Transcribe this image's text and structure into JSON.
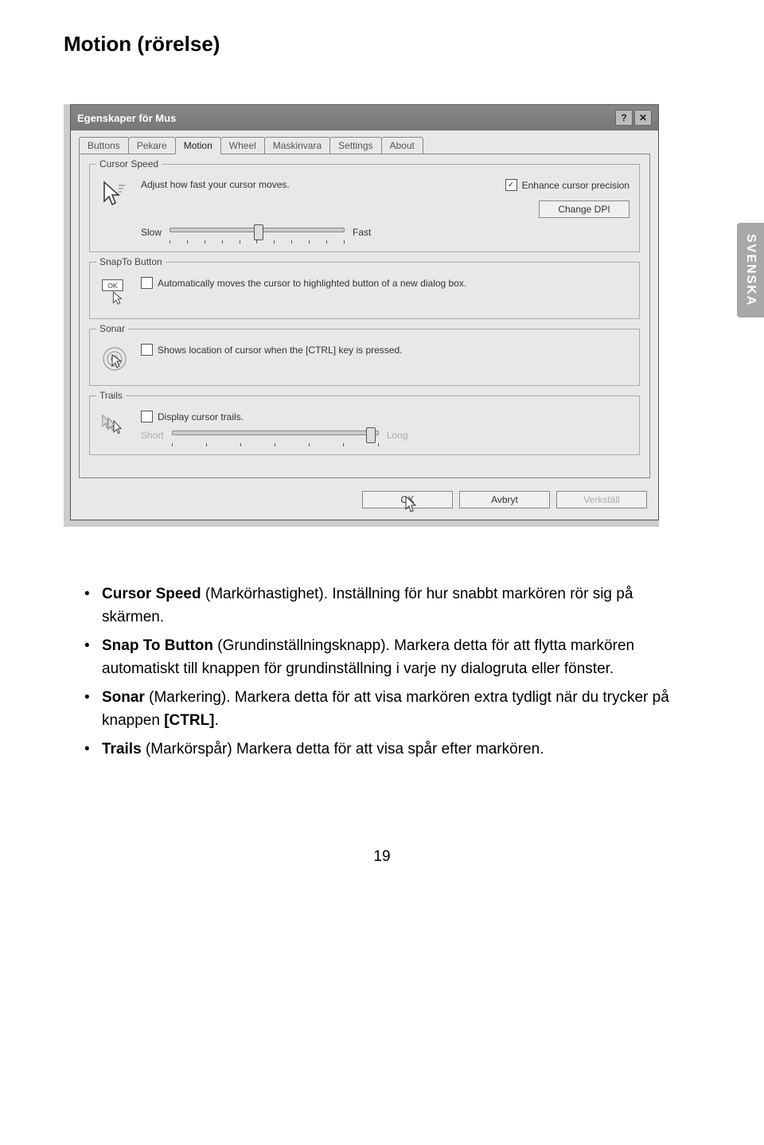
{
  "heading": "Motion (rörelse)",
  "side_tab": "SVENSKA",
  "dialog": {
    "title": "Egenskaper för Mus",
    "help_btn": "?",
    "close_btn": "✕",
    "tabs": [
      "Buttons",
      "Pekare",
      "Motion",
      "Wheel",
      "Maskinvara",
      "Settings",
      "About"
    ],
    "active_tab_index": 2,
    "cursor_speed": {
      "title": "Cursor Speed",
      "adjust_text": "Adjust how fast your cursor moves.",
      "slow": "Slow",
      "fast": "Fast",
      "enhance_label": "Enhance cursor precision",
      "change_dpi": "Change DPI"
    },
    "snap": {
      "title": "SnapTo Button",
      "icon_label": "OK",
      "text": "Automatically moves the cursor to highlighted button of a new dialog box."
    },
    "sonar": {
      "title": "Sonar",
      "text": "Shows location of cursor when the [CTRL] key is pressed."
    },
    "trails": {
      "title": "Trails",
      "text": "Display cursor trails.",
      "short": "Short",
      "long": "Long"
    },
    "buttons": {
      "ok": "OK",
      "cancel": "Avbryt",
      "apply": "Verkställ"
    }
  },
  "bullets": {
    "b1_bold": "Cursor Speed",
    "b1_rest": " (Markörhastighet). Inställning för hur snabbt markören rör sig på skärmen.",
    "b2_bold": "Snap To Button",
    "b2_rest": " (Grundinställningsknapp). Markera detta för att flytta markören automatiskt till knappen för grundinställning i varje ny dialogruta eller fönster.",
    "b3_bold": "Sonar",
    "b3_rest": " (Markering). Markera detta för att visa markören extra tydligt när du trycker på knappen ",
    "b3_bold2": "[CTRL]",
    "b3_end": ".",
    "b4_bold": "Trails",
    "b4_rest": " (Markörspår) Markera detta för att visa spår efter markören."
  },
  "page_number": "19"
}
